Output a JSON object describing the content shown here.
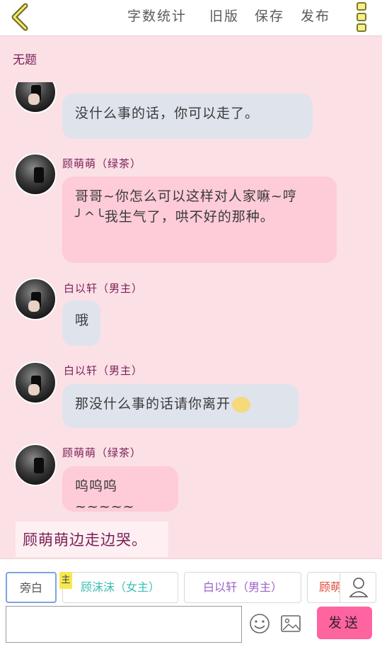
{
  "header": {
    "word_count": "字数统计",
    "old_version": "旧版",
    "save": "保存",
    "publish": "发布"
  },
  "title": "无题",
  "messages": [
    {
      "name": "",
      "text": "没什么事的话，你可以走了。",
      "style": "blue"
    },
    {
      "name": "顾萌萌（绿茶）",
      "text": "哥哥~你怎么可以这样对人家嘛~哼╯^╰我生气了，哄不好的那种。",
      "style": "pink"
    },
    {
      "name": "白以轩（男主）",
      "text": "哦",
      "style": "blue"
    },
    {
      "name": "白以轩（男主）",
      "text": "那没什么事的话请你离开",
      "style": "blue"
    },
    {
      "name": "顾萌萌（绿茶）",
      "text": "呜呜呜~~~~~",
      "style": "pink"
    }
  ],
  "narration": "顾萌萌边走边哭。",
  "roles": {
    "narrator": "旁白",
    "main_tag": "主",
    "female_lead": "顾沫沫（女主）",
    "male_lead": "白以轩（男主）",
    "partial": "顾萌"
  },
  "send_label": "发送",
  "colors": {
    "accent": "#fd64a0",
    "name_color": "#7a1f55",
    "pink_bubble": "#fecbd8",
    "blue_bubble": "#dfe3ec",
    "female_lead_text": "#3bbfb5",
    "male_lead_text": "#9a62c8",
    "partial_text": "#e04a3a"
  }
}
